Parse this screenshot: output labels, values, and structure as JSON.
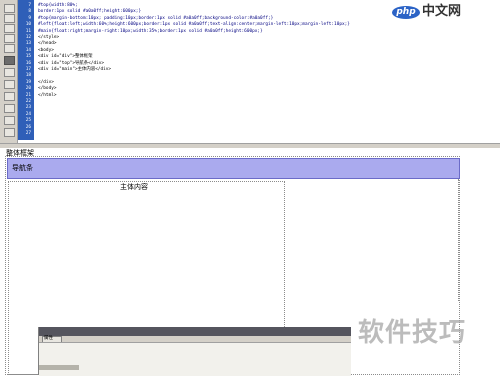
{
  "code": {
    "line_numbers": [
      "7",
      "8",
      "9",
      "10",
      "11",
      "12",
      "13",
      "14",
      "15",
      "16",
      "17",
      "18",
      "19",
      "20",
      "21",
      "22",
      "23",
      "24",
      "25",
      "26",
      "27"
    ],
    "lines": [
      {
        "text": "#top{width:80%;",
        "kind": "css"
      },
      {
        "text": "border:1px solid #a0a0ff;height:600px;}",
        "kind": "css"
      },
      {
        "text": "#top{margin-bottom:10px; padding:10px;border:1px solid #a0a0ff;background-color:#a0a0ff;}",
        "kind": "css"
      },
      {
        "text": "#left{float:left;width:60%;height:600px;border:1px solid #a0a0ff;text-align:center;margin-left:10px;margin-left:10px;}",
        "kind": "css"
      },
      {
        "text": "#main{float:right;margin-right:10px;width:35%;border:1px solid #a0a0ff;height:600px;}",
        "kind": "css"
      },
      {
        "text": "</style>",
        "kind": "tag"
      },
      {
        "text": "</head>",
        "kind": "tag"
      },
      {
        "text": "<body>",
        "kind": "tag"
      },
      {
        "text": "<div id=\"div\">整体框架",
        "kind": "tag"
      },
      {
        "text": "<div id=\"top\">导航条</div>",
        "kind": "tag"
      },
      {
        "text": "<div id=\"main\">主体内容</div>",
        "kind": "tag"
      },
      {
        "text": "",
        "kind": "tag"
      },
      {
        "text": "</div>",
        "kind": "tag"
      },
      {
        "text": "</body>",
        "kind": "tag"
      },
      {
        "text": "</html>",
        "kind": "tag"
      },
      {
        "text": "",
        "kind": "tag"
      },
      {
        "text": "",
        "kind": "tag"
      }
    ]
  },
  "logo": {
    "php": "php",
    "cn": "中文网"
  },
  "design": {
    "outer_label": "整体框架",
    "top_label": "导航条",
    "main_label": "主体内容"
  },
  "properties": {
    "tab_label": "属性"
  },
  "watermark": "软件技巧",
  "colors": {
    "gutter": "#2f5fb8",
    "nav_bar": "#aaaaee",
    "nav_border": "#6b6bc8",
    "panel": "#d4d0c8"
  }
}
